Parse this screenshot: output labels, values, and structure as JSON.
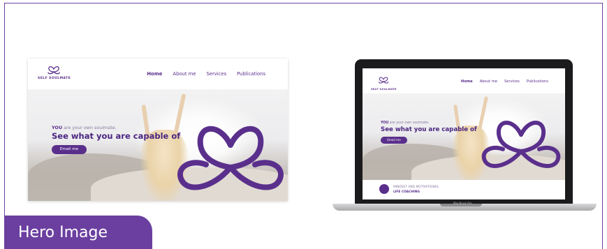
{
  "brand": {
    "accent": "#5a2f8c",
    "tag_bg": "#6b3fa0",
    "logo_name": "heart-infinity-logo"
  },
  "desktop": {
    "logo_text": "SELF SOULMATE",
    "nav": [
      "Home",
      "About me",
      "Services",
      "Publications"
    ],
    "active_nav": "Home",
    "hero": {
      "subtitle_emphasis": "YOU",
      "subtitle_rest": " are your own soulmate.",
      "title": "See what you are capable of",
      "button": "Email me"
    }
  },
  "laptop": {
    "logo_text": "SELF SOULMATE",
    "nav": [
      "Home",
      "About me",
      "Services",
      "Publications"
    ],
    "hero": {
      "subtitle_emphasis": "YOU",
      "subtitle_rest": " are your own soulmate.",
      "title": "See what you are capable of",
      "button": "Email me"
    },
    "footer": {
      "line1": "MINDSET AND MOTIVATIONAL",
      "line2": "LIFE COACHING"
    },
    "device_label": "MacBook Pro"
  },
  "tag": {
    "label": "Hero Image"
  }
}
